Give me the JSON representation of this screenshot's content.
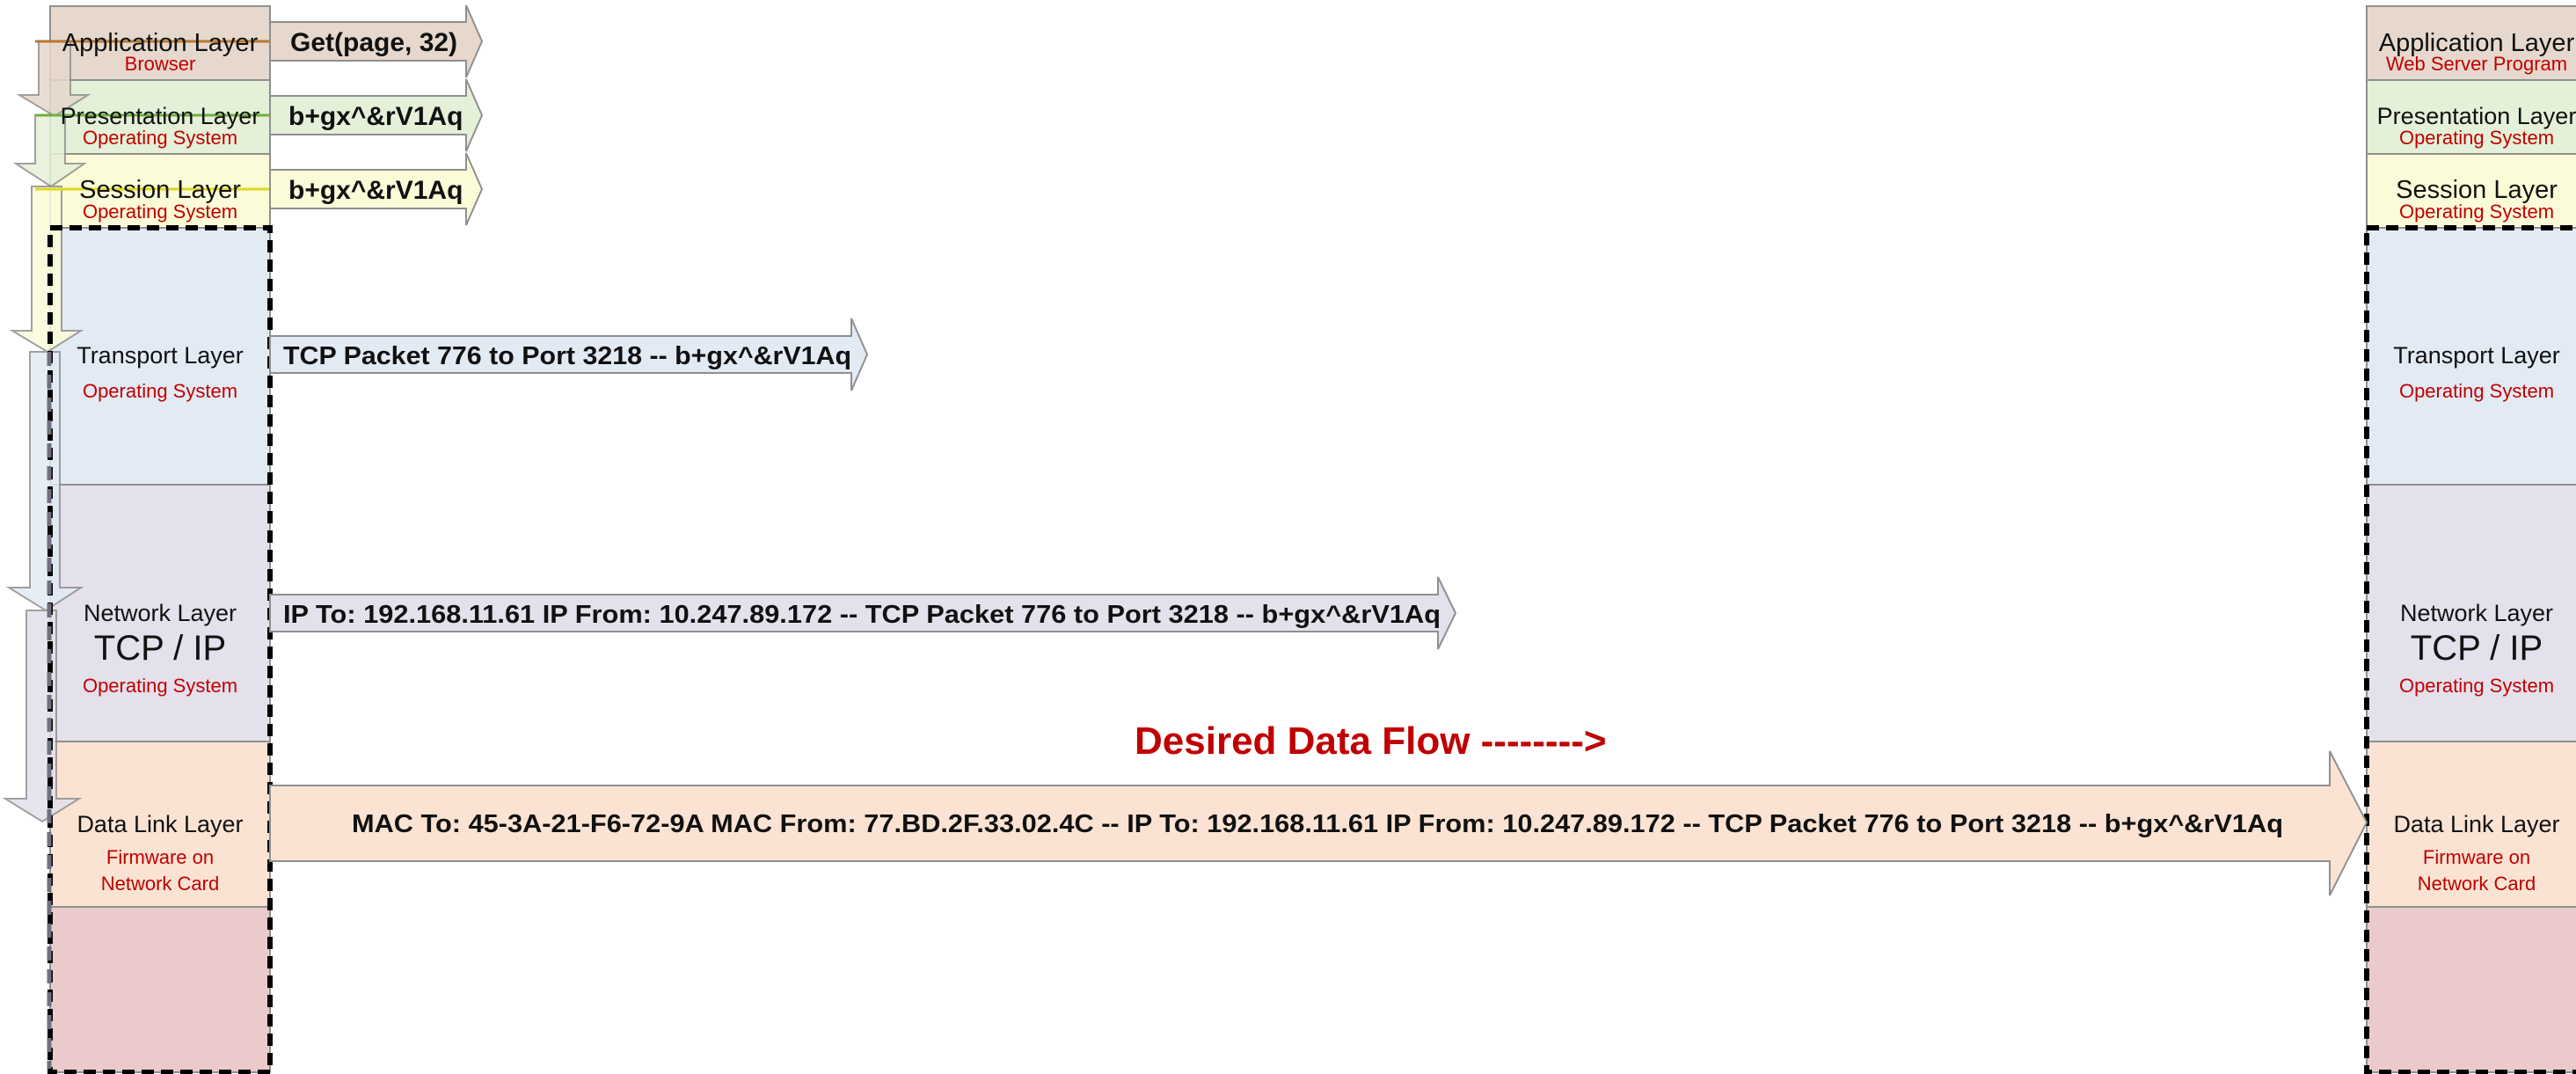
{
  "left_stack": {
    "application": {
      "name": "Application Layer",
      "sub": "Browser"
    },
    "presentation": {
      "name": "Presentation Layer",
      "sub": "Operating System"
    },
    "session": {
      "name": "Session Layer",
      "sub": "Operating System"
    },
    "transport": {
      "name": "Transport Layer",
      "sub": "Operating System"
    },
    "network": {
      "name": "Network Layer",
      "big": "TCP / IP",
      "sub": "Operating System"
    },
    "datalink": {
      "name": "Data Link Layer",
      "sub1": "Firmware on",
      "sub2": "Network Card"
    }
  },
  "right_stack": {
    "application": {
      "name": "Application Layer",
      "sub": "Web  Server Program"
    },
    "presentation": {
      "name": "Presentation Layer",
      "sub": "Operating System"
    },
    "session": {
      "name": "Session Layer",
      "sub": "Operating System"
    },
    "transport": {
      "name": "Transport Layer",
      "sub": "Operating System"
    },
    "network": {
      "name": "Network Layer",
      "big": "TCP / IP",
      "sub": "Operating System"
    },
    "datalink": {
      "name": "Data Link Layer",
      "sub1": "Firmware on",
      "sub2": "Network Card"
    }
  },
  "flow_arrows": {
    "application": "Get(page, 32)",
    "presentation": "b+gx^&rV1Aq",
    "session": "b+gx^&rV1Aq",
    "transport": "TCP Packet 776 to Port 3218 -- b+gx^&rV1Aq",
    "network": "IP To: 192.168.11.61 IP From: 10.247.89.172 -- TCP Packet 776 to Port 3218 -- b+gx^&rV1Aq",
    "datalink": "MAC To: 45-3A-21-F6-72-9A MAC From: 77.BD.2F.33.02.4C -- IP To: 192.168.11.61 IP From: 10.247.89.172 -- TCP Packet 776 to Port 3218 -- b+gx^&rV1Aq"
  },
  "caption": "Desired Data Flow -------->",
  "colors": {
    "application": "#e6d8cc",
    "presentation": "#e4f0d8",
    "session": "#fbfbd8",
    "transport": "#e2eaf4",
    "network": "#e4e0ec",
    "datalink": "#fbe3d3",
    "physical": "#eacaca",
    "sub_text": "#c00000",
    "caption": "#c00000"
  }
}
